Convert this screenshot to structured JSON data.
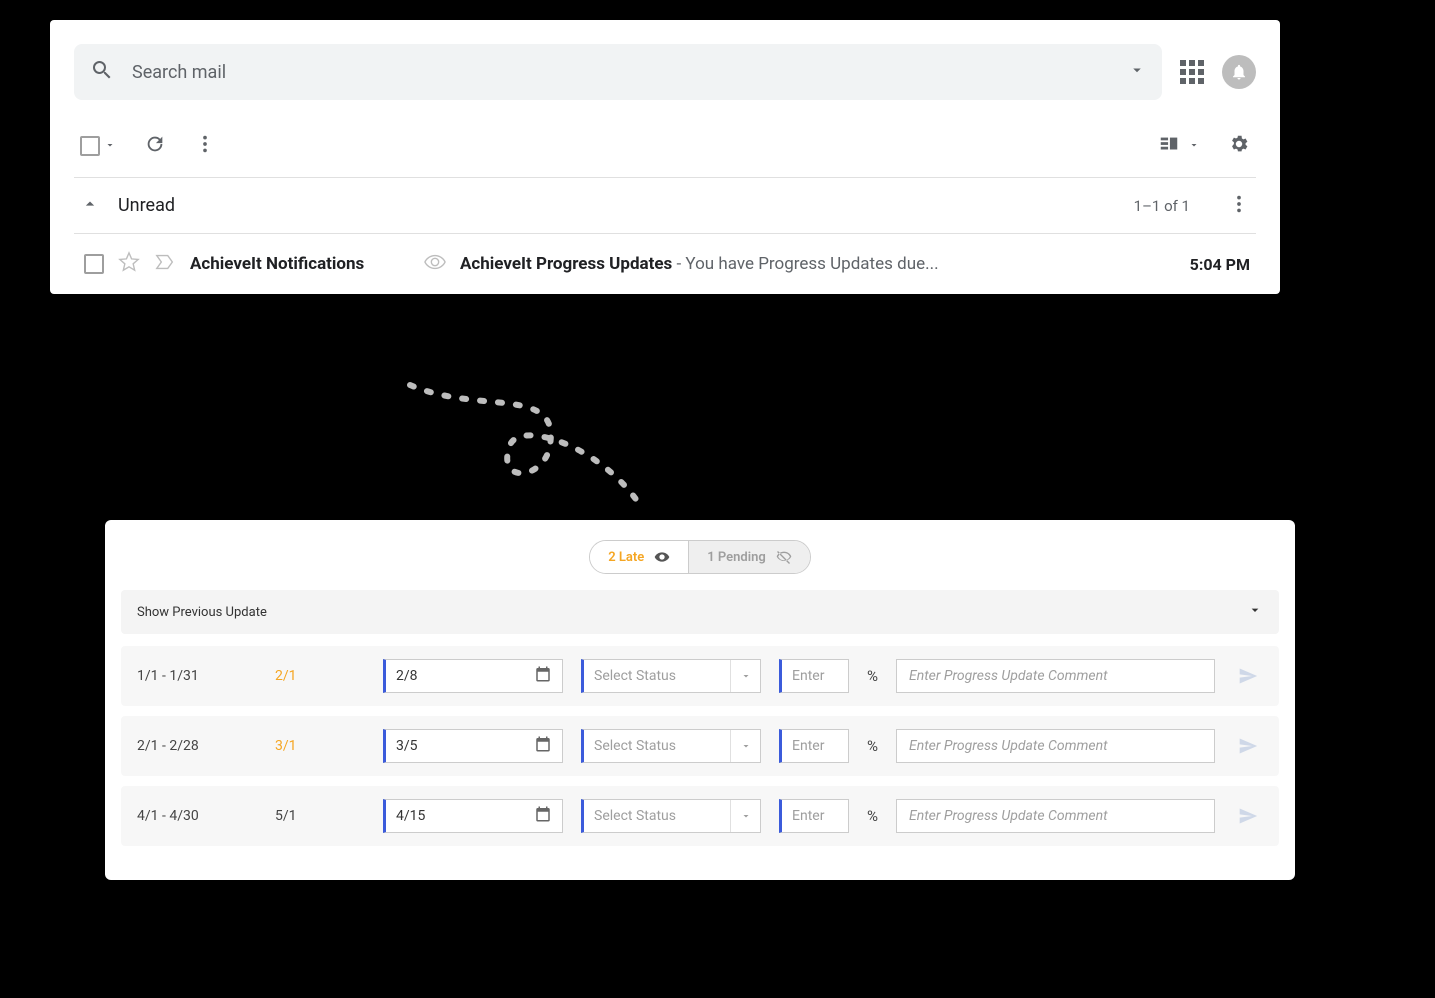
{
  "email": {
    "search_placeholder": "Search mail",
    "section_label": "Unread",
    "section_count": "1–1 of 1",
    "row": {
      "sender": "AchieveIt Notifications",
      "subject": "AchieveIt Progress Updates",
      "preview": " - You have Progress Updates due...",
      "time": "5:04 PM"
    }
  },
  "progress": {
    "pill_late": "2 Late",
    "pill_pending": "1 Pending",
    "accordion_label": "Show Previous Update",
    "status_placeholder": "Select Status",
    "pct_placeholder": "Enter",
    "pct_suffix": "%",
    "comment_placeholder": "Enter Progress Update Comment",
    "rows": [
      {
        "period": "1/1 - 1/31",
        "due": "2/1",
        "due_late": true,
        "date": "2/8"
      },
      {
        "period": "2/1 - 2/28",
        "due": "3/1",
        "due_late": true,
        "date": "3/5"
      },
      {
        "period": "4/1 - 4/30",
        "due": "5/1",
        "due_late": false,
        "date": "4/15"
      }
    ]
  }
}
